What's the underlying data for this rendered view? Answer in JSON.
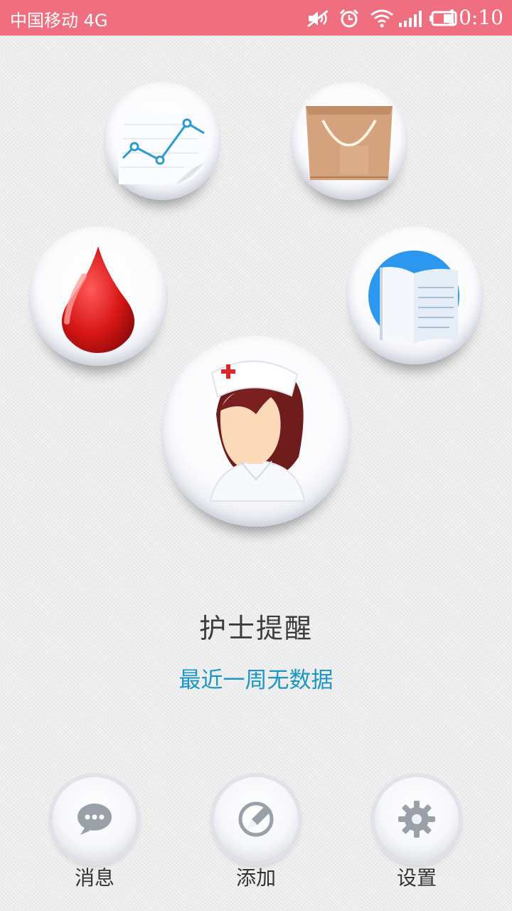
{
  "status_bar": {
    "carrier": "中国移动 4G",
    "time": "10:10",
    "icons": [
      "mute-icon",
      "alarm-icon",
      "wifi-icon",
      "signal-icon",
      "battery-icon"
    ]
  },
  "center": {
    "title": "护士提醒",
    "subtitle": "最近一周无数据",
    "avatar": "nurse-icon"
  },
  "bubbles": [
    "trend-chart-icon",
    "shopping-bag-icon",
    "blood-drop-icon",
    "book-icon"
  ],
  "bottom_nav": {
    "messages": "消息",
    "add": "添加",
    "settings": "设置"
  },
  "colors": {
    "status_bar": "#ef6f80",
    "subtitle": "#1a96c8",
    "title": "#3c3c3c"
  }
}
